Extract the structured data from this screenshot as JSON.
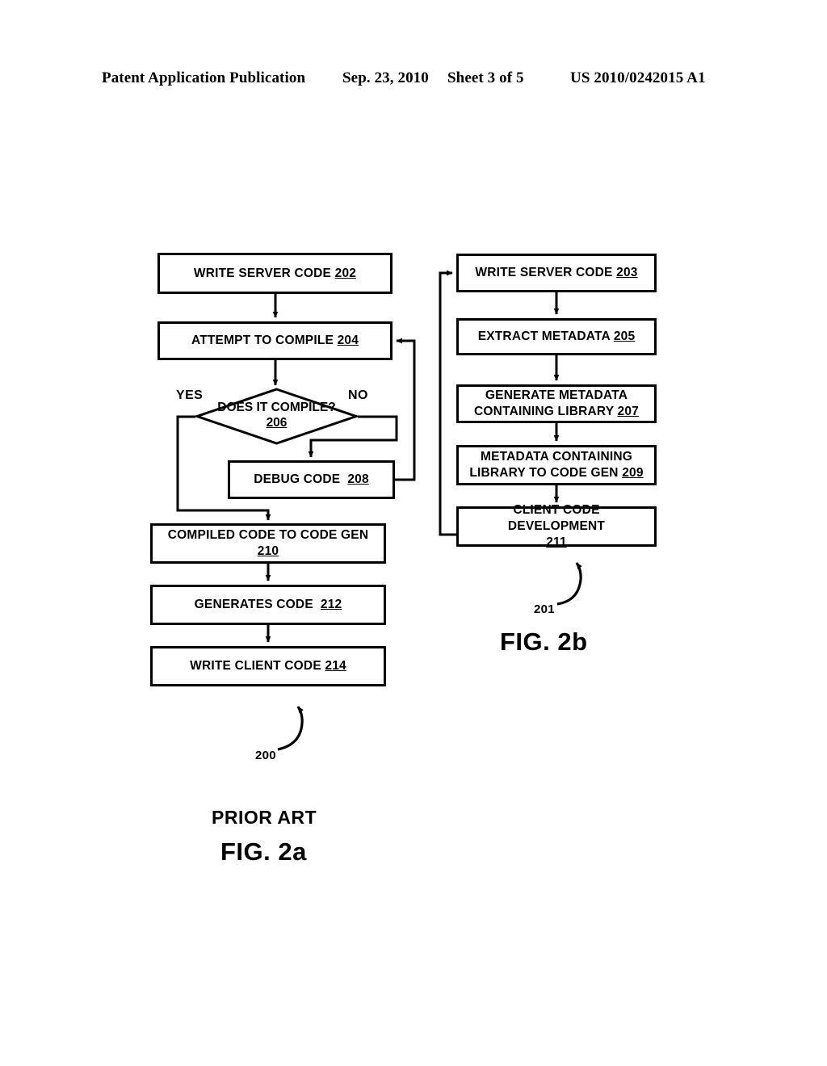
{
  "header": {
    "publication": "Patent Application Publication",
    "date": "Sep. 23, 2010",
    "sheet": "Sheet 3 of 5",
    "patent_number": "US 2010/0242015 A1"
  },
  "figures": [
    {
      "id": "fig-2a",
      "caption": "FIG. 2a",
      "subcaption": "PRIOR ART",
      "reference_numeral": "200",
      "nodes": [
        {
          "id": "202",
          "shape": "process",
          "label": "WRITE SERVER CODE",
          "ref": "202"
        },
        {
          "id": "204",
          "shape": "process",
          "label": "ATTEMPT TO COMPILE",
          "ref": "204"
        },
        {
          "id": "206",
          "shape": "decision",
          "label": "DOES IT COMPILE?",
          "ref": "206"
        },
        {
          "id": "208",
          "shape": "process",
          "label": "DEBUG CODE",
          "ref": "208"
        },
        {
          "id": "210",
          "shape": "process",
          "label": "COMPILED CODE TO CODE GEN",
          "ref": "210"
        },
        {
          "id": "212",
          "shape": "process",
          "label": "GENERATES CODE",
          "ref": "212"
        },
        {
          "id": "214",
          "shape": "process",
          "label": "WRITE CLIENT CODE",
          "ref": "214"
        }
      ],
      "branch_labels": {
        "yes": "YES",
        "no": "NO"
      }
    },
    {
      "id": "fig-2b",
      "caption": "FIG. 2b",
      "reference_numeral": "201",
      "nodes": [
        {
          "id": "203",
          "shape": "process",
          "label": "WRITE SERVER CODE",
          "ref": "203"
        },
        {
          "id": "205",
          "shape": "process",
          "label": "EXTRACT METADATA",
          "ref": "205"
        },
        {
          "id": "207",
          "shape": "process",
          "label_line1": "GENERATE METADATA",
          "label_line2": "CONTAINING LIBRARY",
          "ref": "207"
        },
        {
          "id": "209",
          "shape": "process",
          "label_line1": "METADATA CONTAINING",
          "label_line2": "LIBRARY TO CODE GEN",
          "ref": "209"
        },
        {
          "id": "211",
          "shape": "process",
          "label": "CLIENT CODE DEVELOPMENT",
          "ref": "211"
        }
      ]
    }
  ],
  "colors": {
    "ink": "#000000",
    "paper": "#ffffff"
  }
}
